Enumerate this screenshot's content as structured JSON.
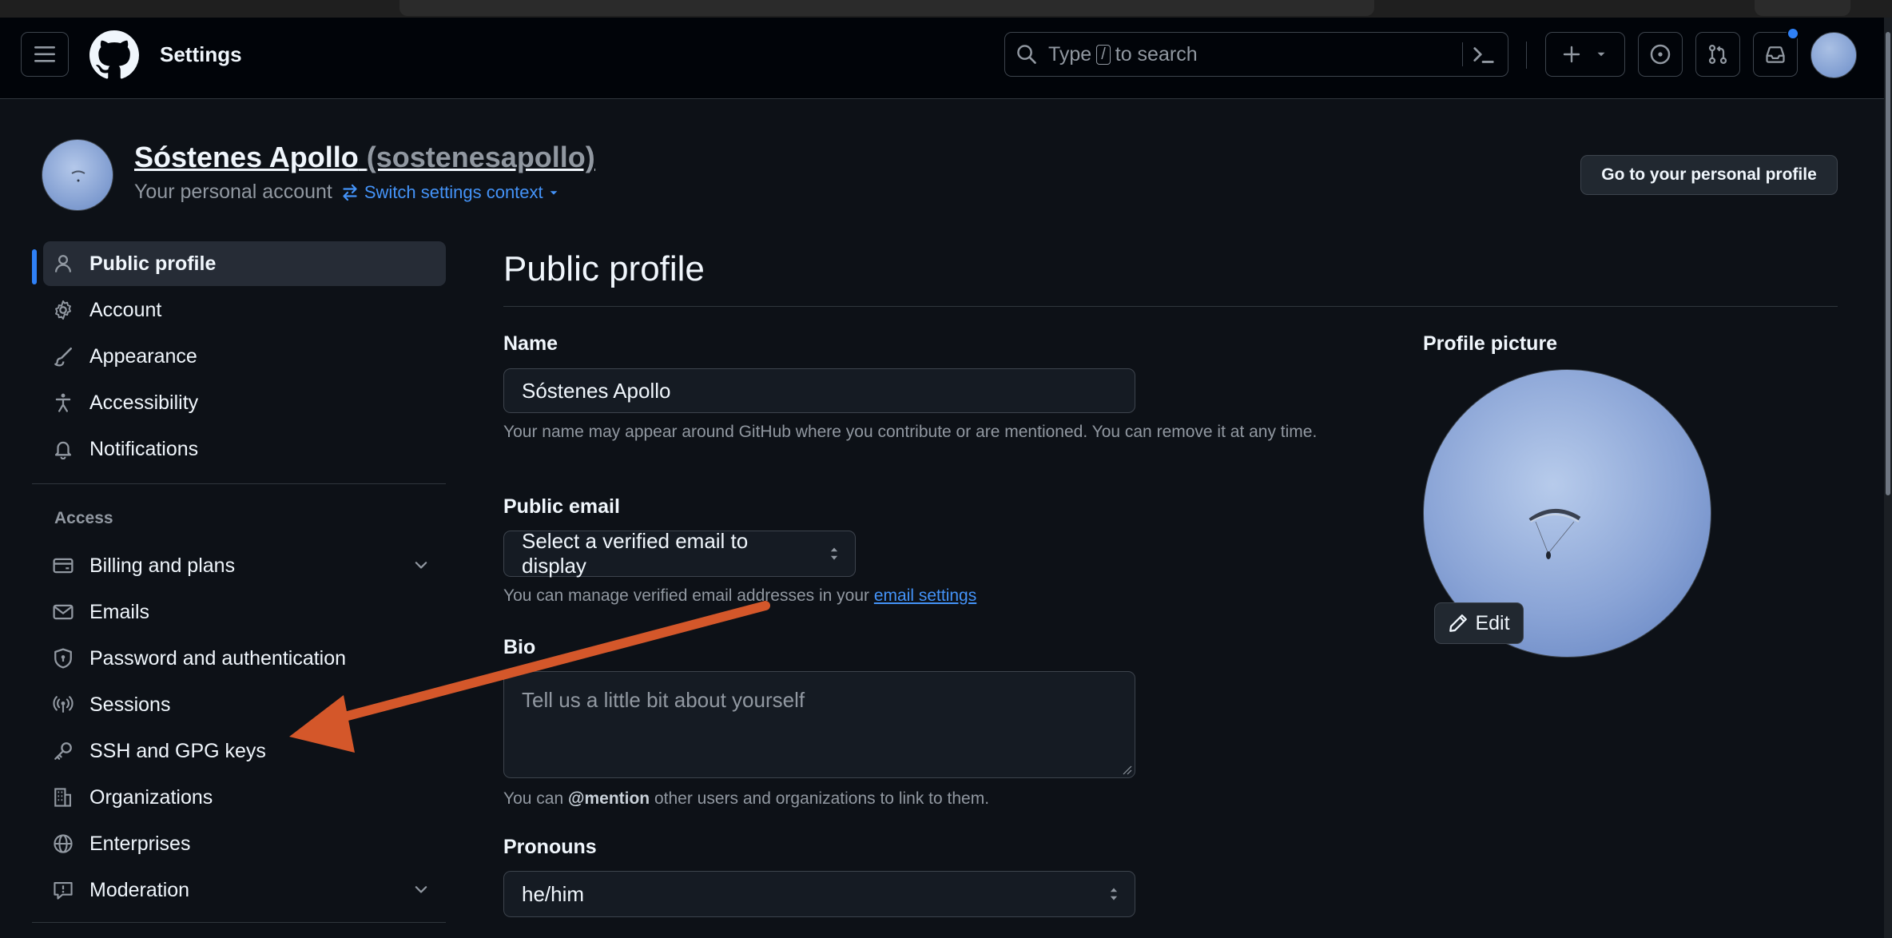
{
  "header": {
    "page_label": "Settings",
    "search": {
      "text_before": "Type",
      "key": "/",
      "text_after": "to search"
    }
  },
  "account": {
    "name": "Sóstenes Apollo",
    "handle": "(sostenesapollo)",
    "subtitle": "Your personal account",
    "switch_context": "Switch settings context",
    "go_to_profile": "Go to your personal profile"
  },
  "sidebar": {
    "items": [
      {
        "label": "Public profile",
        "icon": "person-icon",
        "active": true
      },
      {
        "label": "Account",
        "icon": "gear-icon"
      },
      {
        "label": "Appearance",
        "icon": "paintbrush-icon"
      },
      {
        "label": "Accessibility",
        "icon": "accessibility-icon"
      },
      {
        "label": "Notifications",
        "icon": "bell-icon"
      }
    ],
    "access_heading": "Access",
    "access_items": [
      {
        "label": "Billing and plans",
        "icon": "credit-card-icon",
        "expandable": true
      },
      {
        "label": "Emails",
        "icon": "mail-icon"
      },
      {
        "label": "Password and authentication",
        "icon": "shield-lock-icon"
      },
      {
        "label": "Sessions",
        "icon": "broadcast-icon"
      },
      {
        "label": "SSH and GPG keys",
        "icon": "key-icon"
      },
      {
        "label": "Organizations",
        "icon": "organization-icon"
      },
      {
        "label": "Enterprises",
        "icon": "globe-icon"
      },
      {
        "label": "Moderation",
        "icon": "report-icon",
        "expandable": true
      }
    ]
  },
  "main": {
    "title": "Public profile",
    "name": {
      "label": "Name",
      "value": "Sóstenes Apollo",
      "note": "Your name may appear around GitHub where you contribute or are mentioned. You can remove it at any time."
    },
    "public_email": {
      "label": "Public email",
      "selected": "Select a verified email to display",
      "note_prefix": "You can manage verified email addresses in your",
      "note_link": "email settings"
    },
    "bio": {
      "label": "Bio",
      "placeholder": "Tell us a little bit about yourself",
      "note_prefix": "You can",
      "note_mention": "@mention",
      "note_suffix": "other users and organizations to link to them."
    },
    "pronouns": {
      "label": "Pronouns",
      "selected": "he/him"
    },
    "profile_picture": {
      "label": "Profile picture",
      "edit_label": "Edit"
    }
  },
  "colors": {
    "accent": "#2f81f7",
    "link": "#4493f8",
    "annotation_arrow": "#d4572a",
    "background": "#0d1117"
  }
}
